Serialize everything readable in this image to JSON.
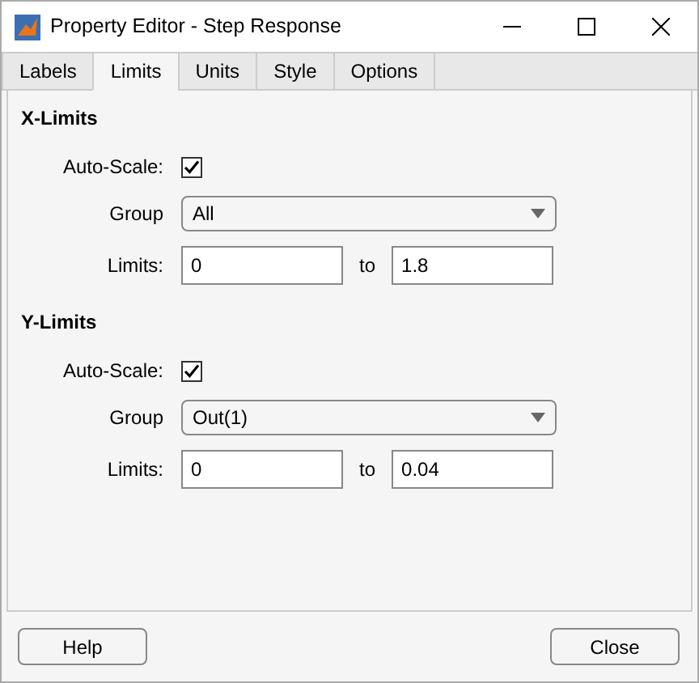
{
  "window": {
    "title": "Property Editor - Step Response"
  },
  "tabs": [
    {
      "label": "Labels",
      "selected": false
    },
    {
      "label": "Limits",
      "selected": true
    },
    {
      "label": "Units",
      "selected": false
    },
    {
      "label": "Style",
      "selected": false
    },
    {
      "label": "Options",
      "selected": false
    }
  ],
  "sections": [
    {
      "title": "X-Limits",
      "auto_scale_label": "Auto-Scale:",
      "auto_scale_checked": true,
      "group_label": "Group",
      "group_value": "All",
      "limits_label": "Limits:",
      "limit_from": "0",
      "to_label": "to",
      "limit_to": "1.8"
    },
    {
      "title": "Y-Limits",
      "auto_scale_label": "Auto-Scale:",
      "auto_scale_checked": true,
      "group_label": "Group",
      "group_value": "Out(1)",
      "limits_label": "Limits:",
      "limit_from": "0",
      "to_label": "to",
      "limit_to": "0.04"
    }
  ],
  "buttons": [
    "Help",
    "Close"
  ]
}
